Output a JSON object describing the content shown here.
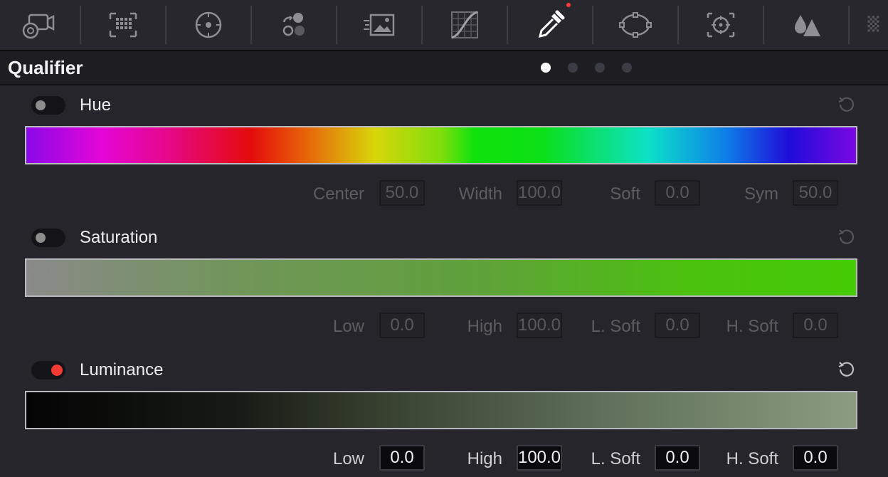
{
  "toolbar": {
    "tools": [
      {
        "icon": "camera-raw-icon"
      },
      {
        "icon": "color-match-icon"
      },
      {
        "icon": "color-wheels-icon"
      },
      {
        "icon": "rgb-mixer-icon"
      },
      {
        "icon": "motion-effects-icon"
      },
      {
        "icon": "curves-icon"
      },
      {
        "icon": "qualifier-eyedropper-icon",
        "active": true
      },
      {
        "icon": "window-power-icon"
      },
      {
        "icon": "tracker-icon"
      },
      {
        "icon": "blur-icon"
      },
      {
        "icon": "key-icon"
      }
    ]
  },
  "header": {
    "title": "Qualifier",
    "pages": 4,
    "active_page": 1
  },
  "hue": {
    "label": "Hue",
    "enabled": false,
    "fields": [
      {
        "label": "Center",
        "value": "50.0"
      },
      {
        "label": "Width",
        "value": "100.0"
      },
      {
        "label": "Soft",
        "value": "0.0"
      },
      {
        "label": "Sym",
        "value": "50.0"
      }
    ]
  },
  "saturation": {
    "label": "Saturation",
    "enabled": false,
    "fields": [
      {
        "label": "Low",
        "value": "0.0"
      },
      {
        "label": "High",
        "value": "100.0"
      },
      {
        "label": "L. Soft",
        "value": "0.0"
      },
      {
        "label": "H. Soft",
        "value": "0.0"
      }
    ]
  },
  "luminance": {
    "label": "Luminance",
    "enabled": true,
    "fields": [
      {
        "label": "Low",
        "value": "0.0"
      },
      {
        "label": "High",
        "value": "100.0"
      },
      {
        "label": "L. Soft",
        "value": "0.0"
      },
      {
        "label": "H. Soft",
        "value": "0.0"
      }
    ]
  },
  "colors": {
    "toggle_on": "#f23a35",
    "toggle_off_knob": "#8d8d8d",
    "background": "#25252b"
  }
}
